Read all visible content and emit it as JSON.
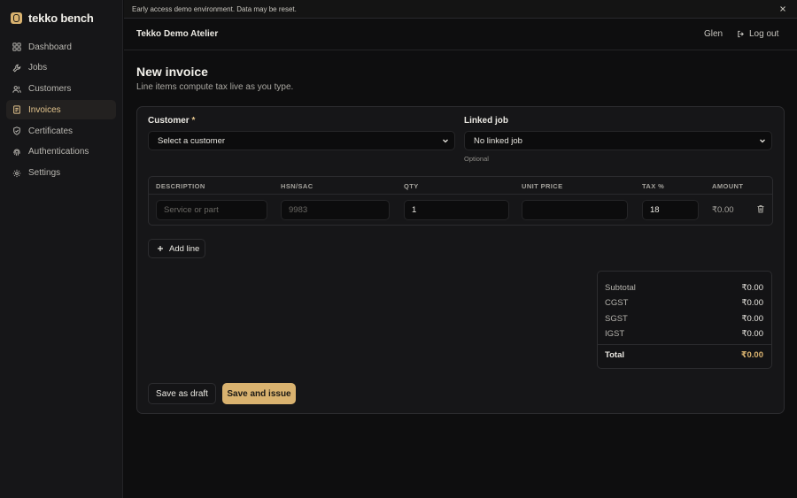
{
  "app": {
    "brand": "tekko bench",
    "accent": "#d9b26f"
  },
  "sidebar": {
    "items": [
      {
        "label": "Dashboard",
        "icon": "dashboard-icon"
      },
      {
        "label": "Jobs",
        "icon": "wrench-icon"
      },
      {
        "label": "Customers",
        "icon": "users-icon"
      },
      {
        "label": "Invoices",
        "icon": "document-icon",
        "active": true
      },
      {
        "label": "Certificates",
        "icon": "shield-check-icon"
      },
      {
        "label": "Authentications",
        "icon": "fingerprint-icon"
      },
      {
        "label": "Settings",
        "icon": "gear-icon"
      }
    ]
  },
  "banner": {
    "text": "Early access demo environment. Data may be reset."
  },
  "topbar": {
    "org": "Tekko Demo Atelier",
    "user": "Glen",
    "logout": "Log out"
  },
  "page": {
    "title": "New invoice",
    "subtitle": "Line items compute tax live as you type."
  },
  "form": {
    "customer": {
      "label": "Customer",
      "required_mark": "*",
      "value": "Select a customer"
    },
    "linked_job": {
      "label": "Linked job",
      "value": "No linked job",
      "hint": "Optional"
    }
  },
  "line_items": {
    "columns": [
      "DESCRIPTION",
      "HSN/SAC",
      "QTY",
      "UNIT PRICE",
      "TAX %",
      "AMOUNT"
    ],
    "rows": [
      {
        "description_placeholder": "Service or part",
        "hsn_placeholder": "9983",
        "qty": "1",
        "unit_price": "",
        "tax": "18",
        "amount": "₹0.00"
      }
    ],
    "add_label": "Add line"
  },
  "totals": {
    "subtotal": {
      "label": "Subtotal",
      "value": "₹0.00"
    },
    "cgst": {
      "label": "CGST",
      "value": "₹0.00"
    },
    "sgst": {
      "label": "SGST",
      "value": "₹0.00"
    },
    "igst": {
      "label": "IGST",
      "value": "₹0.00"
    },
    "total": {
      "label": "Total",
      "value": "₹0.00"
    }
  },
  "actions": {
    "draft": "Save as draft",
    "issue": "Save and issue"
  }
}
